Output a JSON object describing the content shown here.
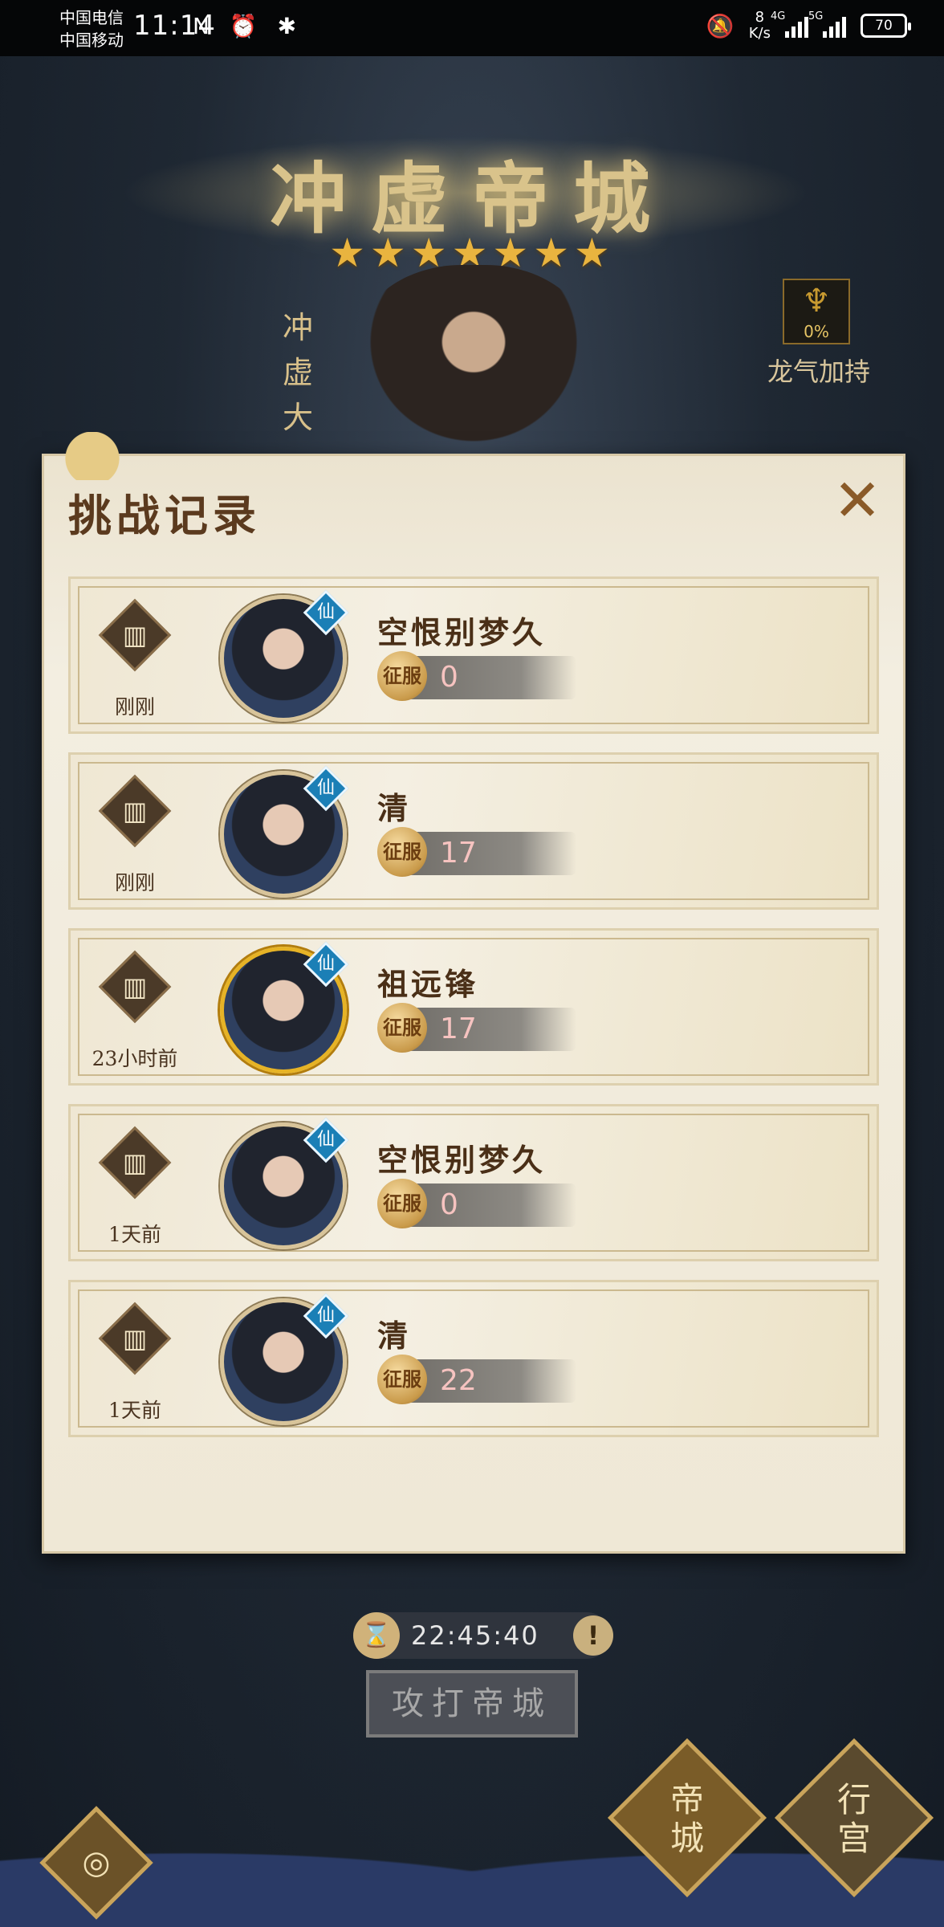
{
  "status_bar": {
    "carrier_1": "中国电信",
    "carrier_2": "中国移动",
    "time": "11:14",
    "icons": "N ⏰ ✱",
    "speed_value": "8",
    "speed_unit": "K/s",
    "signal_1": "4G",
    "signal_2": "5G",
    "battery": "70"
  },
  "scene": {
    "city_title": "冲虚帝城",
    "star_count": 7,
    "stars": "★★★★★★★",
    "vertical_name": "冲虚大",
    "dragon_power_percent": "0%",
    "dragon_power_label": "龙气加持"
  },
  "dialog": {
    "title": "挑战记录",
    "close": "✕",
    "records": [
      {
        "time": "刚刚",
        "name": "空恨别梦久",
        "badge": "仙",
        "coin": "征服",
        "score": "0",
        "frame": "silver"
      },
      {
        "time": "刚刚",
        "name": "清",
        "badge": "仙",
        "coin": "征服",
        "score": "17",
        "frame": "silver"
      },
      {
        "time": "23小时前",
        "name": "祖远锋",
        "badge": "仙",
        "coin": "征服",
        "score": "17",
        "frame": "gold"
      },
      {
        "time": "1天前",
        "name": "空恨别梦久",
        "badge": "仙",
        "coin": "征服",
        "score": "0",
        "frame": "silver"
      },
      {
        "time": "1天前",
        "name": "清",
        "badge": "仙",
        "coin": "征服",
        "score": "22",
        "frame": "silver"
      }
    ]
  },
  "bottom": {
    "timer": "22:45:40",
    "info": "!",
    "attack_button": "攻打帝城",
    "tab_city": "帝城",
    "tab_palace": "行宫"
  }
}
